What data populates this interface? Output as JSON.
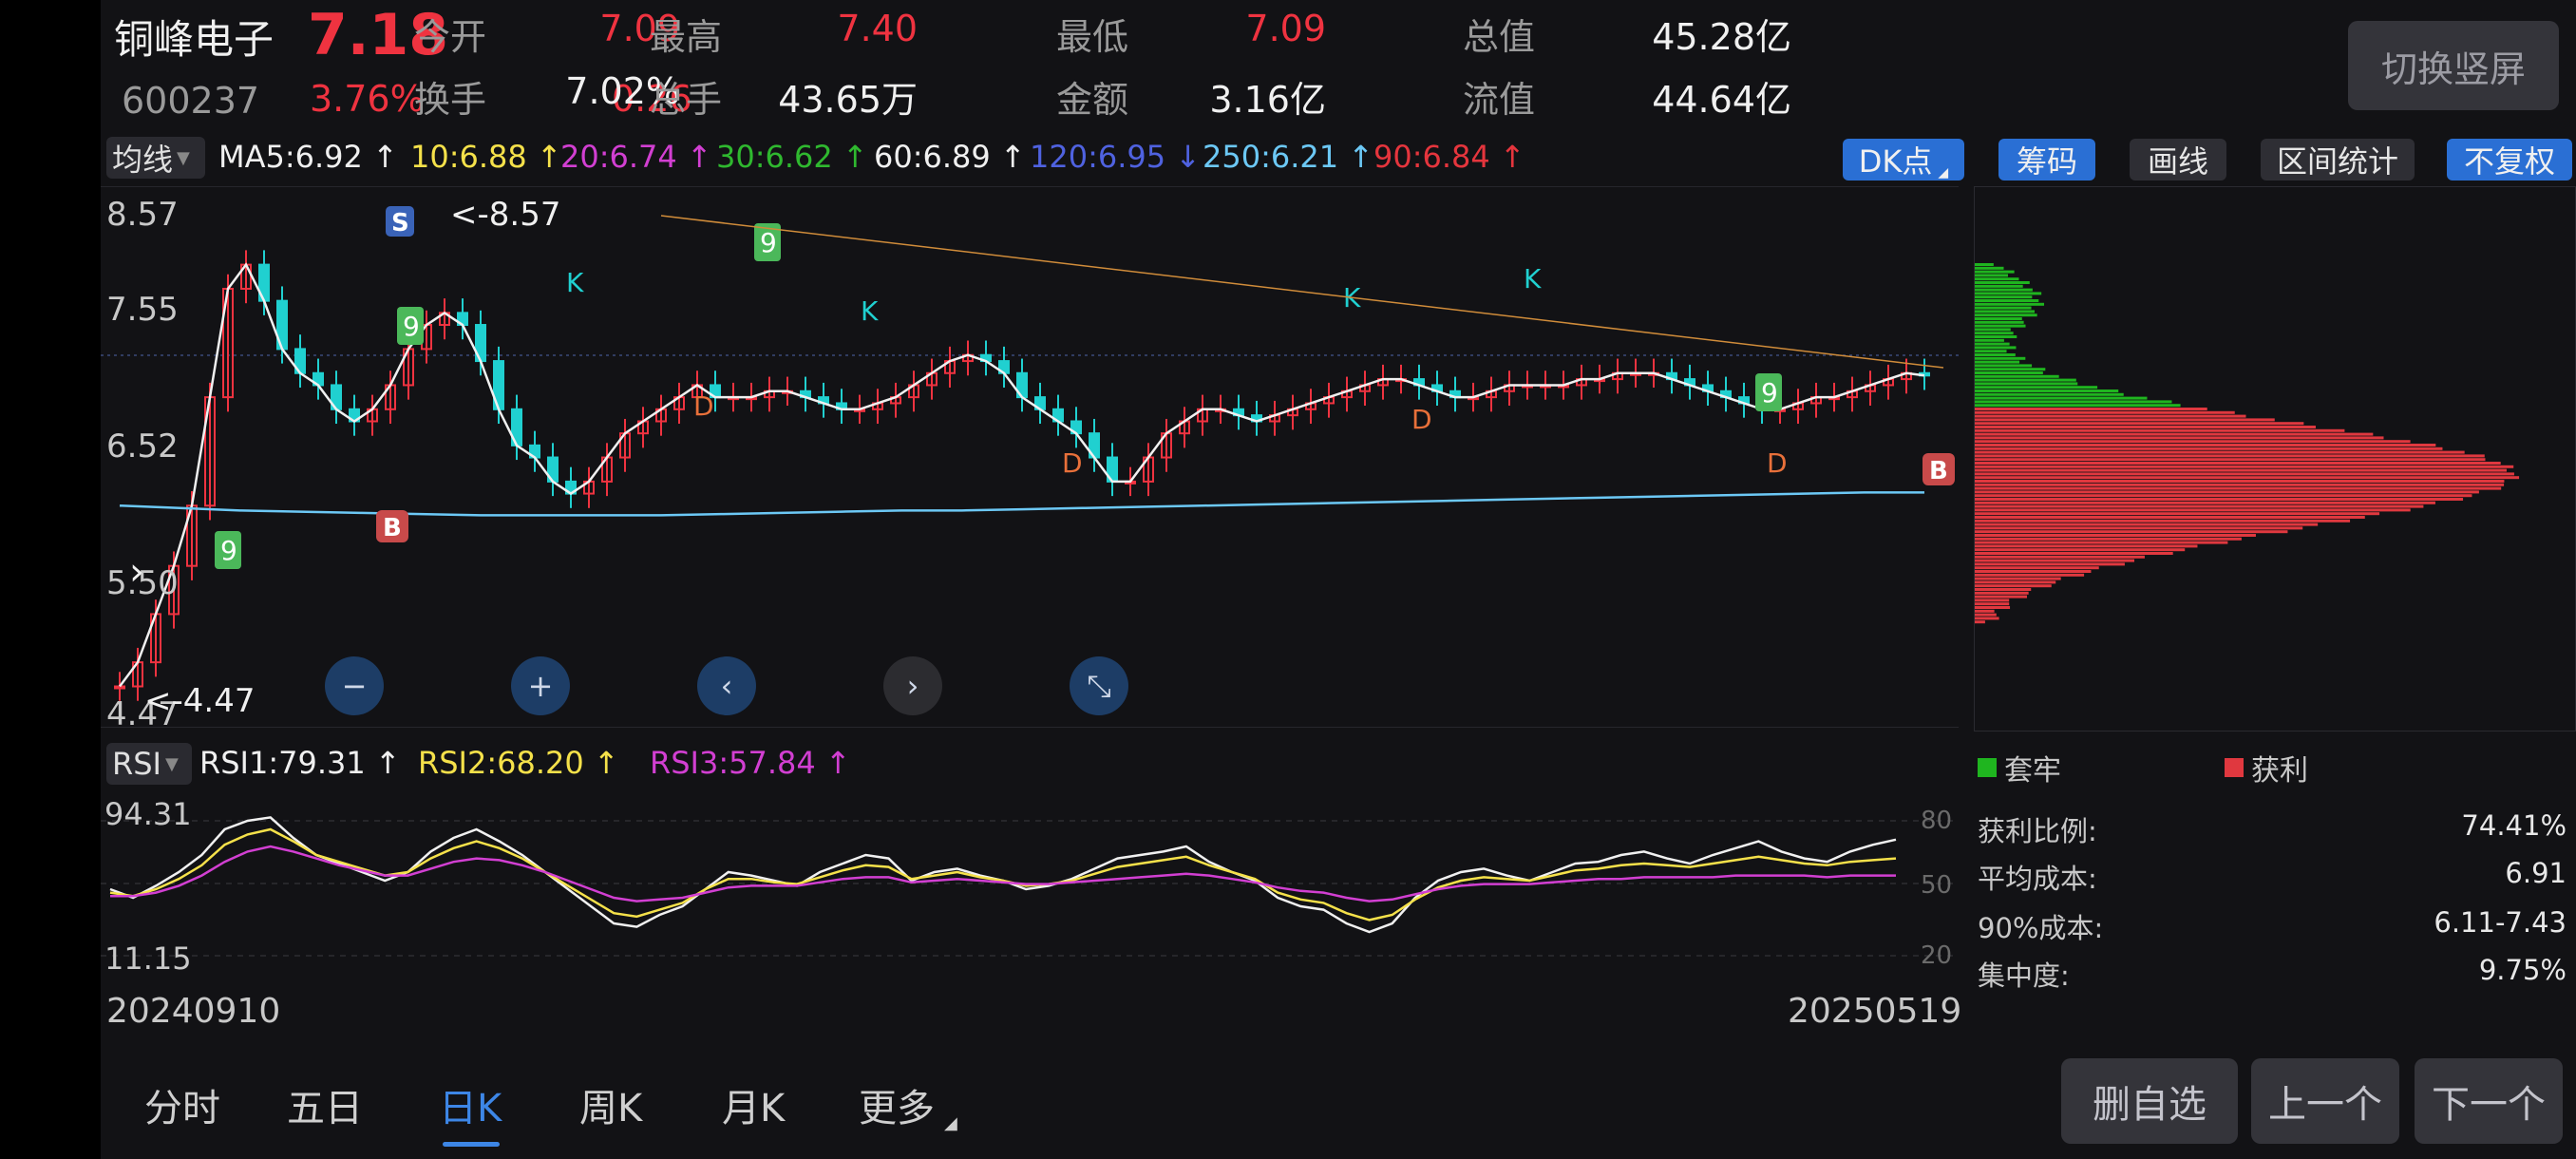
{
  "stock": {
    "name": "铜峰电子",
    "price": "7.18",
    "code": "600237",
    "change_pct": "3.76%",
    "change": "0.26"
  },
  "stats": [
    {
      "label": "今开",
      "value": "7.09",
      "color": "red"
    },
    {
      "label": "最高",
      "value": "7.40",
      "color": "red"
    },
    {
      "label": "最低",
      "value": "7.09",
      "color": "red"
    },
    {
      "label": "总值",
      "value": "45.28亿",
      "color": "white"
    },
    {
      "label": "换手",
      "value": "7.02%",
      "color": "white"
    },
    {
      "label": "总手",
      "value": "43.65万",
      "color": "white"
    },
    {
      "label": "金额",
      "value": "3.16亿",
      "color": "white"
    },
    {
      "label": "流值",
      "value": "44.64亿",
      "color": "white"
    }
  ],
  "switch_label": "切换竖屏",
  "ma": {
    "type_label": "均线",
    "items": [
      {
        "text": "MA5:6.92 ↑",
        "color": "#f0f0f0"
      },
      {
        "text": "10:6.88 ↑",
        "color": "#f5e14a"
      },
      {
        "text": "20:6.74 ↑",
        "color": "#d23fd2"
      },
      {
        "text": "30:6.62 ↑",
        "color": "#2fb82f"
      },
      {
        "text": "60:6.89 ↑",
        "color": "#f0f0f0"
      },
      {
        "text": "120:6.95 ↓",
        "color": "#4f62e0"
      },
      {
        "text": "250:6.21 ↑",
        "color": "#6cc8f5"
      },
      {
        "text": "90:6.84 ↑",
        "color": "#e5353d"
      }
    ]
  },
  "tools": {
    "dk": "DK点",
    "chips": "筹码",
    "draw": "画线",
    "interval": "区间统计",
    "adjust": "不复权"
  },
  "price_axis": {
    "labels": [
      "8.57",
      "7.55",
      "6.52",
      "5.50",
      "4.47"
    ],
    "high_mark": "<-8.57",
    "low_mark": "<-4.47"
  },
  "chart_markers": {
    "buy": "B",
    "sell": "S",
    "k": "K",
    "d": "D",
    "nine": "9"
  },
  "rsi": {
    "type_label": "RSI",
    "rsi1": "RSI1:79.31 ↑",
    "rsi2": "RSI2:68.20 ↑",
    "rsi3": "RSI3:57.84 ↑",
    "max_label": "94.31",
    "min_label": "11.15",
    "levels": [
      "80",
      "50",
      "20"
    ]
  },
  "dates": {
    "start": "20240910",
    "end": "20250519"
  },
  "chips": {
    "legend_trapped": "套牢",
    "legend_profit": "获利",
    "stats": [
      {
        "label": "获利比例:",
        "value": "74.41%"
      },
      {
        "label": "平均成本:",
        "value": "6.91"
      },
      {
        "label": "90%成本:",
        "value": "6.11-7.43"
      },
      {
        "label": "集中度:",
        "value": "9.75%"
      }
    ]
  },
  "tabs": [
    "分时",
    "五日",
    "日K",
    "周K",
    "月K",
    "更多"
  ],
  "active_tab": "日K",
  "bottom_buttons": {
    "remove": "删自选",
    "prev": "上一个",
    "next": "下一个"
  },
  "colors": {
    "up": "#ef3340",
    "down": "#20d0d0",
    "accent": "#2a6fd4",
    "profit": "#e0383f",
    "trapped": "#1fb51f"
  },
  "chart_data": [
    {
      "type": "line",
      "title": "",
      "x_range": [
        "20240910",
        "20250519"
      ],
      "ylim": [
        4.47,
        8.57
      ],
      "series": [
        {
          "name": "MA5",
          "x": [
            0,
            10,
            20,
            30,
            40,
            50,
            60,
            70,
            80,
            90,
            100,
            110,
            120,
            130,
            140,
            150,
            160,
            170,
            180,
            190,
            200,
            210,
            220,
            230,
            240,
            250,
            260,
            270,
            280,
            290,
            300,
            310,
            320,
            330,
            340,
            350,
            360,
            370,
            380,
            390,
            400,
            410,
            420,
            430,
            440,
            450,
            460,
            470,
            480,
            490,
            500,
            510,
            520,
            530,
            540,
            550,
            560,
            570,
            580,
            590,
            600,
            610,
            620,
            630,
            640,
            650,
            660,
            670,
            680,
            690,
            700,
            710,
            720,
            730,
            740,
            750,
            760,
            770,
            780,
            790,
            800,
            810,
            820,
            830,
            840,
            850,
            860,
            870,
            880,
            890,
            900,
            910,
            920,
            930,
            940,
            950,
            960,
            970,
            980,
            990,
            1000
          ],
          "values": [
            4.6,
            4.8,
            5.2,
            5.6,
            6.1,
            7.0,
            7.9,
            8.1,
            7.8,
            7.4,
            7.2,
            7.1,
            6.9,
            6.8,
            6.9,
            7.1,
            7.4,
            7.6,
            7.7,
            7.6,
            7.3,
            6.9,
            6.6,
            6.5,
            6.3,
            6.2,
            6.3,
            6.5,
            6.7,
            6.8,
            6.9,
            7.0,
            7.1,
            7.0,
            7.0,
            7.0,
            7.05,
            7.05,
            7.0,
            6.95,
            6.9,
            6.9,
            6.95,
            7.0,
            7.1,
            7.2,
            7.3,
            7.35,
            7.3,
            7.2,
            7.0,
            6.9,
            6.8,
            6.7,
            6.5,
            6.3,
            6.3,
            6.5,
            6.7,
            6.8,
            6.9,
            6.9,
            6.85,
            6.8,
            6.85,
            6.9,
            6.95,
            7.0,
            7.05,
            7.1,
            7.15,
            7.15,
            7.1,
            7.05,
            7.0,
            7.0,
            7.05,
            7.1,
            7.1,
            7.1,
            7.1,
            7.15,
            7.15,
            7.2,
            7.2,
            7.2,
            7.15,
            7.1,
            7.05,
            7.0,
            6.95,
            6.9,
            6.9,
            6.95,
            7.0,
            7.0,
            7.05,
            7.1,
            7.15,
            7.2,
            7.18
          ]
        },
        {
          "name": "MA250",
          "values": [
            6.1,
            6.08,
            6.06,
            6.05,
            6.04,
            6.03,
            6.02,
            6.02,
            6.02,
            6.02,
            6.03,
            6.04,
            6.05,
            6.06,
            6.06,
            6.07,
            6.08,
            6.09,
            6.1,
            6.11,
            6.12,
            6.13,
            6.14,
            6.15,
            6.16,
            6.17,
            6.18,
            6.19,
            6.2,
            6.21,
            6.21
          ]
        }
      ]
    },
    {
      "type": "line",
      "title": "",
      "ylim": [
        0,
        100
      ],
      "series": [
        {
          "name": "RSI1",
          "values": [
            50,
            45,
            52,
            60,
            70,
            85,
            90,
            92,
            80,
            70,
            65,
            60,
            55,
            60,
            72,
            80,
            85,
            78,
            70,
            60,
            50,
            40,
            30,
            28,
            35,
            40,
            50,
            60,
            58,
            55,
            52,
            60,
            65,
            70,
            68,
            55,
            60,
            62,
            58,
            55,
            50,
            52,
            56,
            62,
            68,
            70,
            72,
            75,
            66,
            60,
            55,
            45,
            40,
            38,
            30,
            25,
            30,
            45,
            55,
            60,
            62,
            58,
            55,
            60,
            65,
            66,
            70,
            72,
            68,
            65,
            70,
            74,
            78,
            72,
            68,
            66,
            72,
            76,
            79
          ]
        },
        {
          "name": "RSI2",
          "values": [
            48,
            46,
            50,
            56,
            64,
            76,
            82,
            85,
            78,
            70,
            66,
            62,
            58,
            60,
            68,
            74,
            78,
            74,
            68,
            60,
            52,
            44,
            36,
            34,
            38,
            42,
            50,
            56,
            56,
            54,
            53,
            57,
            61,
            64,
            63,
            56,
            58,
            60,
            57,
            55,
            52,
            53,
            55,
            59,
            63,
            65,
            67,
            69,
            64,
            60,
            56,
            48,
            44,
            42,
            36,
            32,
            35,
            44,
            51,
            55,
            57,
            56,
            55,
            58,
            61,
            62,
            64,
            65,
            64,
            63,
            65,
            67,
            69,
            67,
            65,
            64,
            66,
            67,
            68
          ]
        },
        {
          "name": "RSI3",
          "values": [
            46,
            46,
            48,
            52,
            58,
            66,
            72,
            75,
            72,
            68,
            64,
            61,
            58,
            58,
            62,
            66,
            68,
            67,
            64,
            60,
            55,
            50,
            45,
            43,
            44,
            45,
            48,
            51,
            52,
            52,
            52,
            54,
            56,
            57,
            57,
            54,
            55,
            56,
            55,
            54,
            53,
            53,
            54,
            55,
            56,
            57,
            58,
            59,
            58,
            56,
            54,
            51,
            49,
            48,
            45,
            43,
            44,
            47,
            50,
            52,
            53,
            53,
            53,
            54,
            55,
            56,
            56,
            57,
            57,
            57,
            57,
            58,
            58,
            58,
            58,
            57,
            58,
            58,
            58
          ]
        }
      ]
    }
  ]
}
